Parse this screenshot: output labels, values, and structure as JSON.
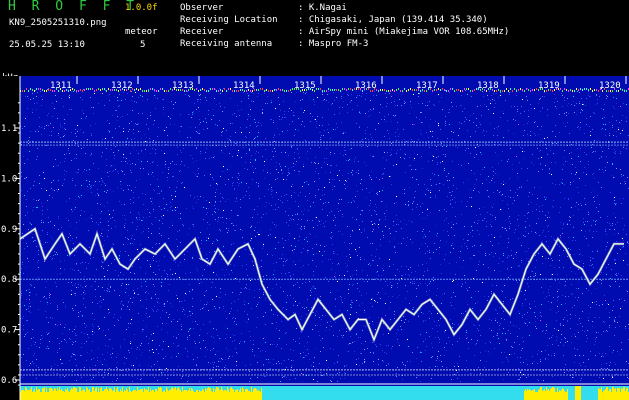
{
  "header": {
    "title": "H R O F F T",
    "version": "1.0.0f",
    "filename": "KN9_2505251310.png",
    "meteor_label": "meteor",
    "datetime": "25.05.25 13:10",
    "meteor_count": "5",
    "info": [
      {
        "label": "Observer",
        "value": ": K.Nagai"
      },
      {
        "label": "Receiving Location",
        "value": ": Chigasaki, Japan (139.414 35.340)"
      },
      {
        "label": "Receiver",
        "value": ": AirSpy mini (Miakejima VOR 108.65MHz)"
      },
      {
        "label": "Receiving antenna",
        "value": ": Maspro FM-3"
      }
    ]
  },
  "axis": {
    "unit": "kHz",
    "y_ticks": [
      "1.1",
      "1.0",
      "0.9",
      "0.8",
      "0.7",
      "0.6"
    ],
    "time_ticks": [
      "1311",
      "1312",
      "1313",
      "1314",
      "1315",
      "1316",
      "1317",
      "1318",
      "1319",
      "1320"
    ]
  },
  "colors": {
    "background": "#000000",
    "noise_bg": "#000cb0",
    "title": "#2ecc40",
    "version": "#ffd900",
    "trace": "#ffffff",
    "bottom_yellow": "#ffee00",
    "bottom_cyan": "#33ddee"
  }
}
